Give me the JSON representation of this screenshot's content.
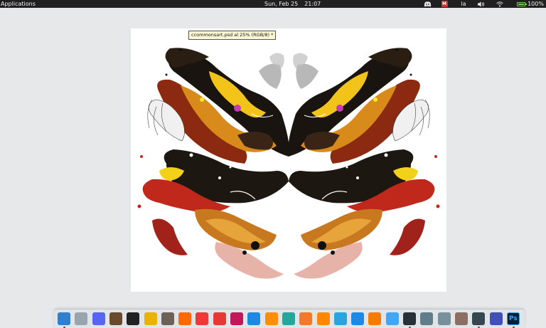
{
  "panel": {
    "applications_label": "Applications",
    "date": "Sun, Feb 25",
    "time": "21:07",
    "keyboard_layout": "la",
    "battery_percent": "100%",
    "battery_level": 1.0,
    "indicators": [
      "discord-icon",
      "mail-icon",
      "keyboard-layout",
      "volume-icon",
      "network-icon",
      "battery-icon"
    ]
  },
  "document": {
    "tooltip": "ccommonsart.psd al 25% (RGB/8) *"
  },
  "dock": {
    "apps": [
      {
        "name": "multitasking-view",
        "icon": "grid-icon",
        "color": "#2f80d0"
      },
      {
        "name": "files",
        "icon": "folder-icon",
        "color": "#9aa4ad"
      },
      {
        "name": "discord",
        "icon": "discord-icon",
        "color": "#5865f2"
      },
      {
        "name": "books",
        "icon": "books-icon",
        "color": "#6b4a2b"
      },
      {
        "name": "inkscape",
        "icon": "inkscape-icon",
        "color": "#222222"
      },
      {
        "name": "pencil",
        "icon": "pencil-icon",
        "color": "#e8b400"
      },
      {
        "name": "gimp",
        "icon": "gimp-icon",
        "color": "#6d6258"
      },
      {
        "name": "firefox",
        "icon": "firefox-icon",
        "color": "#ff6a00"
      },
      {
        "name": "vivaldi",
        "icon": "vivaldi-icon",
        "color": "#ef3939"
      },
      {
        "name": "youtube-player",
        "icon": "play-circle-icon",
        "color": "#e53935"
      },
      {
        "name": "shield-app",
        "icon": "shield-icon",
        "color": "#c2185b"
      },
      {
        "name": "media-player",
        "icon": "circle-play-icon",
        "color": "#1e88e5"
      },
      {
        "name": "video-player",
        "icon": "play-icon",
        "color": "#ff8f00"
      },
      {
        "name": "disk-app",
        "icon": "gear-icon",
        "color": "#26a69a"
      },
      {
        "name": "blender",
        "icon": "blender-icon",
        "color": "#f5792a"
      },
      {
        "name": "vlc",
        "icon": "vlc-icon",
        "color": "#ff8800"
      },
      {
        "name": "telegram",
        "icon": "telegram-icon",
        "color": "#2aa3de"
      },
      {
        "name": "messages",
        "icon": "chat-icon",
        "color": "#1e88e5"
      },
      {
        "name": "archive",
        "icon": "archive-icon",
        "color": "#f57c00"
      },
      {
        "name": "photos",
        "icon": "image-icon",
        "color": "#42a5f5"
      },
      {
        "name": "terminal",
        "icon": "terminal-icon",
        "color": "#263238"
      },
      {
        "name": "keyboard",
        "icon": "keyboard-icon",
        "color": "#607d8b"
      },
      {
        "name": "settings-toggle",
        "icon": "toggle-icon",
        "color": "#78909c"
      },
      {
        "name": "calculator",
        "icon": "calculator-icon",
        "color": "#8d6e63"
      },
      {
        "name": "monitor",
        "icon": "monitor-icon",
        "color": "#37474f"
      },
      {
        "name": "gnome-app",
        "icon": "g-icon",
        "color": "#3f51b5"
      },
      {
        "name": "photoshop",
        "icon": "ps-icon",
        "color": "#001e36",
        "label": "Ps"
      }
    ]
  }
}
